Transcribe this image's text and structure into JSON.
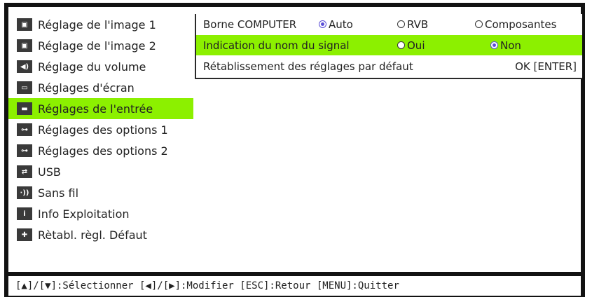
{
  "sidebar": {
    "items": [
      {
        "label": "Réglage de l'image 1",
        "icon": "image-icon",
        "glyph": "▣"
      },
      {
        "label": "Réglage de l'image 2",
        "icon": "image-icon",
        "glyph": "▣"
      },
      {
        "label": "Réglage du volume",
        "icon": "speaker-icon",
        "glyph": "◀)"
      },
      {
        "label": "Réglages d'écran",
        "icon": "screen-icon",
        "glyph": "▭"
      },
      {
        "label": "Réglages de l'entrée",
        "icon": "input-icon",
        "glyph": "▬"
      },
      {
        "label": "Réglages des options 1",
        "icon": "options-icon",
        "glyph": "⊶"
      },
      {
        "label": "Réglages des options 2",
        "icon": "options-icon",
        "glyph": "⊶"
      },
      {
        "label": "USB",
        "icon": "usb-icon",
        "glyph": "⇄"
      },
      {
        "label": "Sans fil",
        "icon": "wireless-icon",
        "glyph": "·))"
      },
      {
        "label": "Info Exploitation",
        "icon": "info-icon",
        "glyph": "i"
      },
      {
        "label": "Rètabl. règl. Défaut",
        "icon": "reset-icon",
        "glyph": "✚"
      }
    ],
    "selected_index": 4
  },
  "panel": {
    "row1": {
      "label": "Borne COMPUTER",
      "options": [
        "Auto",
        "RVB",
        "Composantes"
      ],
      "selected": "Auto"
    },
    "row2": {
      "label": "Indication du nom du signal",
      "options": [
        "Oui",
        "Non"
      ],
      "selected": "Non"
    },
    "row3": {
      "label": "Rétablissement des réglages par défaut",
      "action": "OK [ENTER]"
    }
  },
  "footer": {
    "text": "[▲]/[▼]:Sélectionner [◀]/[▶]:Modifier [ESC]:Retour [MENU]:Quitter"
  },
  "colors": {
    "highlight": "#8cf000",
    "frame": "#121212",
    "radio_on": "#5b4fd6"
  }
}
